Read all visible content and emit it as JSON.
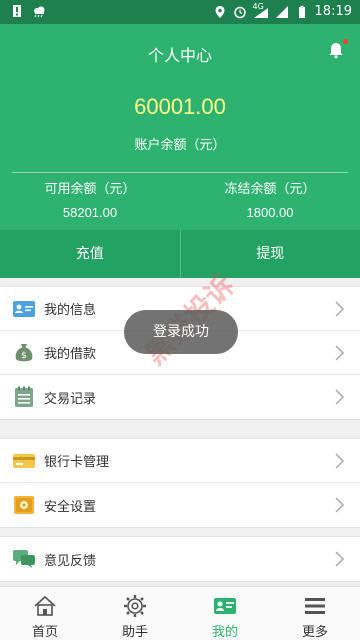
{
  "statusbar": {
    "time": "18:19",
    "network_label": "4G",
    "icons": [
      "notification-icon",
      "cloud-icon",
      "location-icon",
      "alarm-icon",
      "wifi-icon",
      "signal-icon",
      "battery-icon"
    ]
  },
  "header": {
    "title": "个人中心",
    "balance_value": "60001.00",
    "balance_label": "账户余额（元）",
    "available_label": "可用余额（元）",
    "available_value": "58201.00",
    "frozen_label": "冻结余额（元）",
    "frozen_value": "1800.00",
    "colors": {
      "primary": "#2db26f",
      "balance": "#fffb88",
      "accent": "#ff3b30"
    }
  },
  "actions": {
    "recharge": "充值",
    "withdraw": "提现"
  },
  "menu": {
    "groups": [
      [
        {
          "label": "我的信息",
          "icon": "id-card-icon"
        },
        {
          "label": "我的借款",
          "icon": "money-bag-icon"
        },
        {
          "label": "交易记录",
          "icon": "notepad-icon"
        }
      ],
      [
        {
          "label": "银行卡管理",
          "icon": "bank-card-icon"
        },
        {
          "label": "安全设置",
          "icon": "safe-icon"
        }
      ],
      [
        {
          "label": "意见反馈",
          "icon": "chat-bubble-icon"
        }
      ]
    ]
  },
  "toast": {
    "text": "登录成功"
  },
  "watermark": {
    "text": "黑猫投诉"
  },
  "tabbar": {
    "tabs": [
      {
        "label": "首页",
        "icon": "home-icon"
      },
      {
        "label": "助手",
        "icon": "gear-icon"
      },
      {
        "label": "我的",
        "icon": "profile-card-icon",
        "active": true
      },
      {
        "label": "更多",
        "icon": "menu-lines-icon"
      }
    ]
  }
}
